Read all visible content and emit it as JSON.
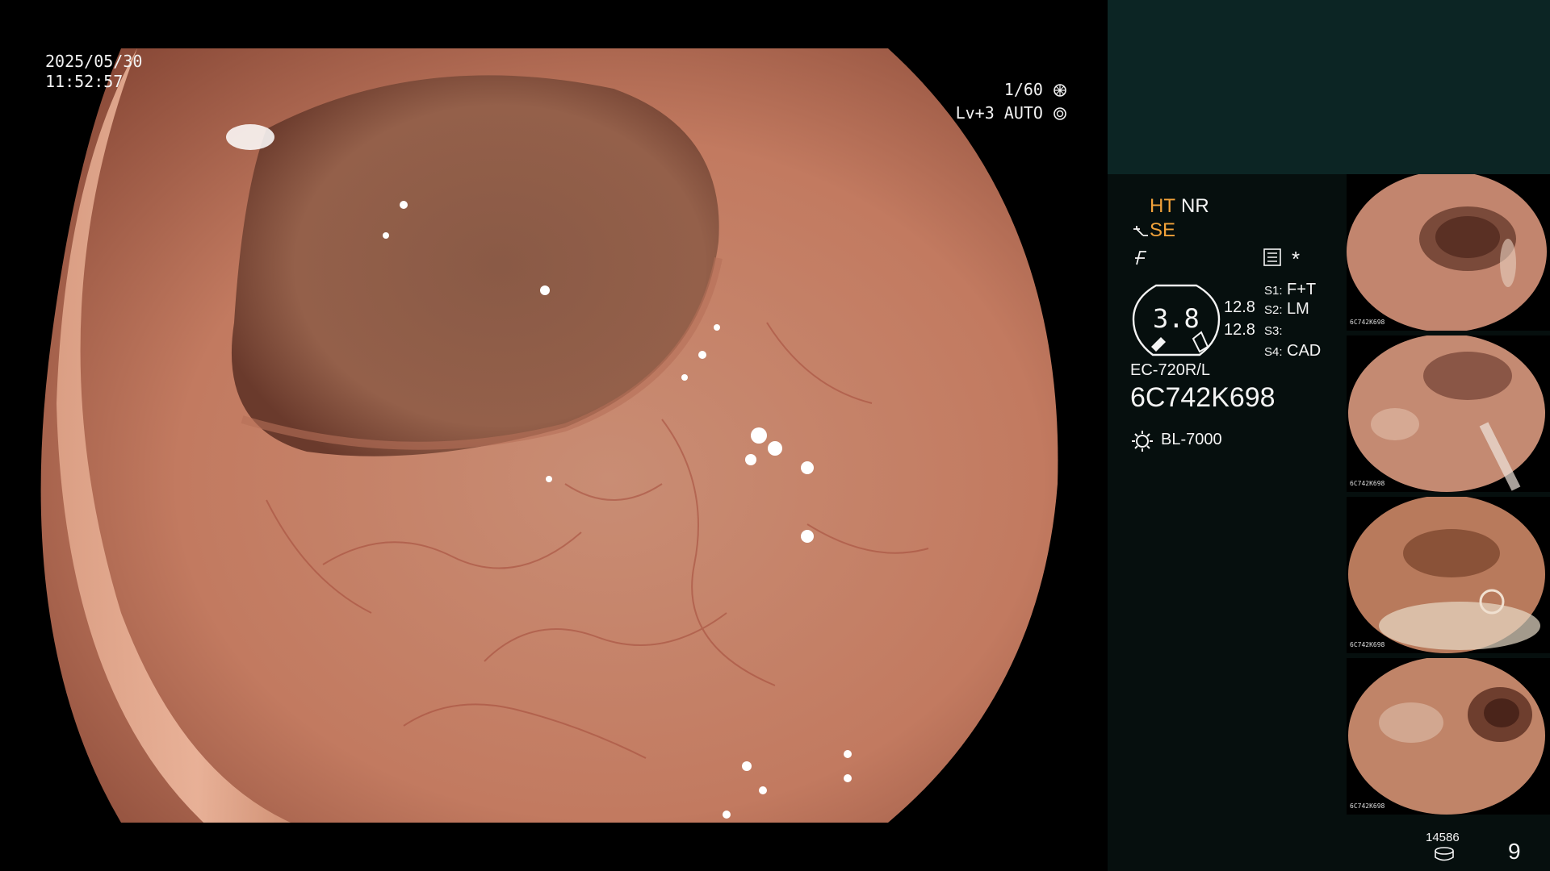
{
  "overlay": {
    "date": "2025/05/30",
    "time": "11:52:57",
    "shutter": "1/60",
    "level": "Lv+3 AUTO"
  },
  "status": {
    "ht": "HT",
    "nr": "NR",
    "se": "SE",
    "asterisk": "*",
    "zoom_value": "3.8",
    "ratio_top": "12.8",
    "ratio_bottom": "12.8",
    "s1_label": "S1:",
    "s1_value": "F+T",
    "s2_label": "S2:",
    "s2_value": "LM",
    "s3_label": "S3:",
    "s3_value": "",
    "s4_label": "S4:",
    "s4_value": "CAD",
    "scope_model": "EC-720R/L",
    "serial": "6C742K698",
    "light_source": "BL-7000"
  },
  "thumbnails": [
    {
      "label": "6C742K698"
    },
    {
      "label": "6C742K698"
    },
    {
      "label": "6C742K698"
    },
    {
      "label": "6C742K698"
    }
  ],
  "footer": {
    "storage_count": "14586",
    "image_count": "9"
  },
  "colors": {
    "panel_bg": "#060f0e",
    "top_band": "#0c2524",
    "accent_orange": "#f2a23a",
    "mucosa": "#c8826a"
  }
}
